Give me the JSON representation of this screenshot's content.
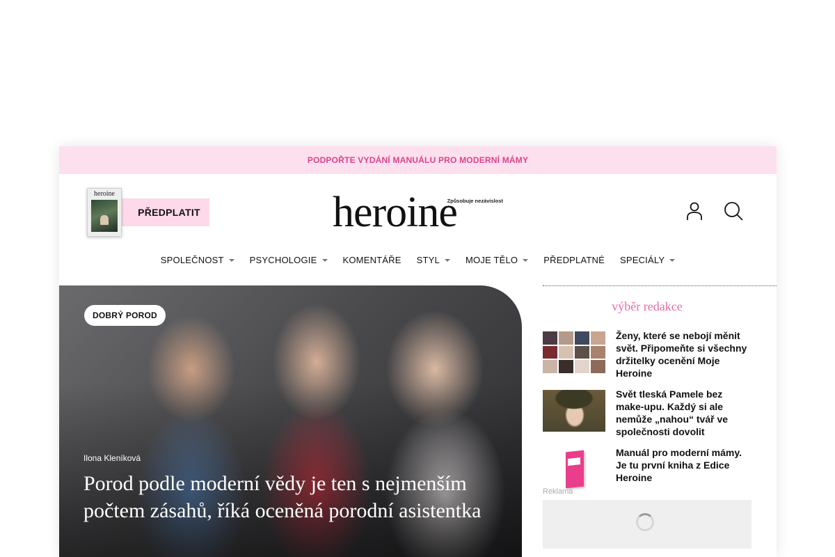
{
  "promo": {
    "label": "PODPOŘTE VYDÁNÍ MANUÁLU PRO MODERNÍ MÁMY"
  },
  "header": {
    "magazine_cover_title": "heroine",
    "subscribe_label": "PŘEDPLATIT",
    "logo": {
      "wordmark": "heroine",
      "tagline": "Způsobuje nezávislost"
    },
    "icons": [
      "user-icon",
      "search-icon"
    ]
  },
  "nav": {
    "items": [
      {
        "label": "SPOLEČNOST",
        "has_dropdown": true
      },
      {
        "label": "PSYCHOLOGIE",
        "has_dropdown": true
      },
      {
        "label": "KOMENTÁŘE",
        "has_dropdown": false
      },
      {
        "label": "STYL",
        "has_dropdown": true
      },
      {
        "label": "MOJE TĚLO",
        "has_dropdown": true
      },
      {
        "label": "PŘEDPLATNÉ",
        "has_dropdown": false
      },
      {
        "label": "SPECIÁLY",
        "has_dropdown": true
      }
    ]
  },
  "hero": {
    "badge": "DOBRÝ POROD",
    "author": "Ilona Kleníková",
    "title": "Porod podle moderní vědy je ten s nejmenším počtem zásahů, říká oceněná porodní asistentka"
  },
  "sidebar": {
    "title": "výběr redakce",
    "items": [
      {
        "title": "Ženy, které se nebojí měnit svět. Připomeňte si všechny držitelky ocenění Moje Heroine"
      },
      {
        "title": "Svět tleská Pamele bez make-upu. Každý si ale nemůže „nahou“ tvář ve společnosti dovolit"
      },
      {
        "title": "Manuál pro moderní mámy. Je tu první kniha z Edice Heroine"
      }
    ],
    "ad_label": "Reklama"
  },
  "colors": {
    "brand_pink": "#e96aa6",
    "promo_bg": "#fde0ee",
    "promo_text": "#e0418e",
    "subscribe_bg": "#fdd9e9"
  }
}
